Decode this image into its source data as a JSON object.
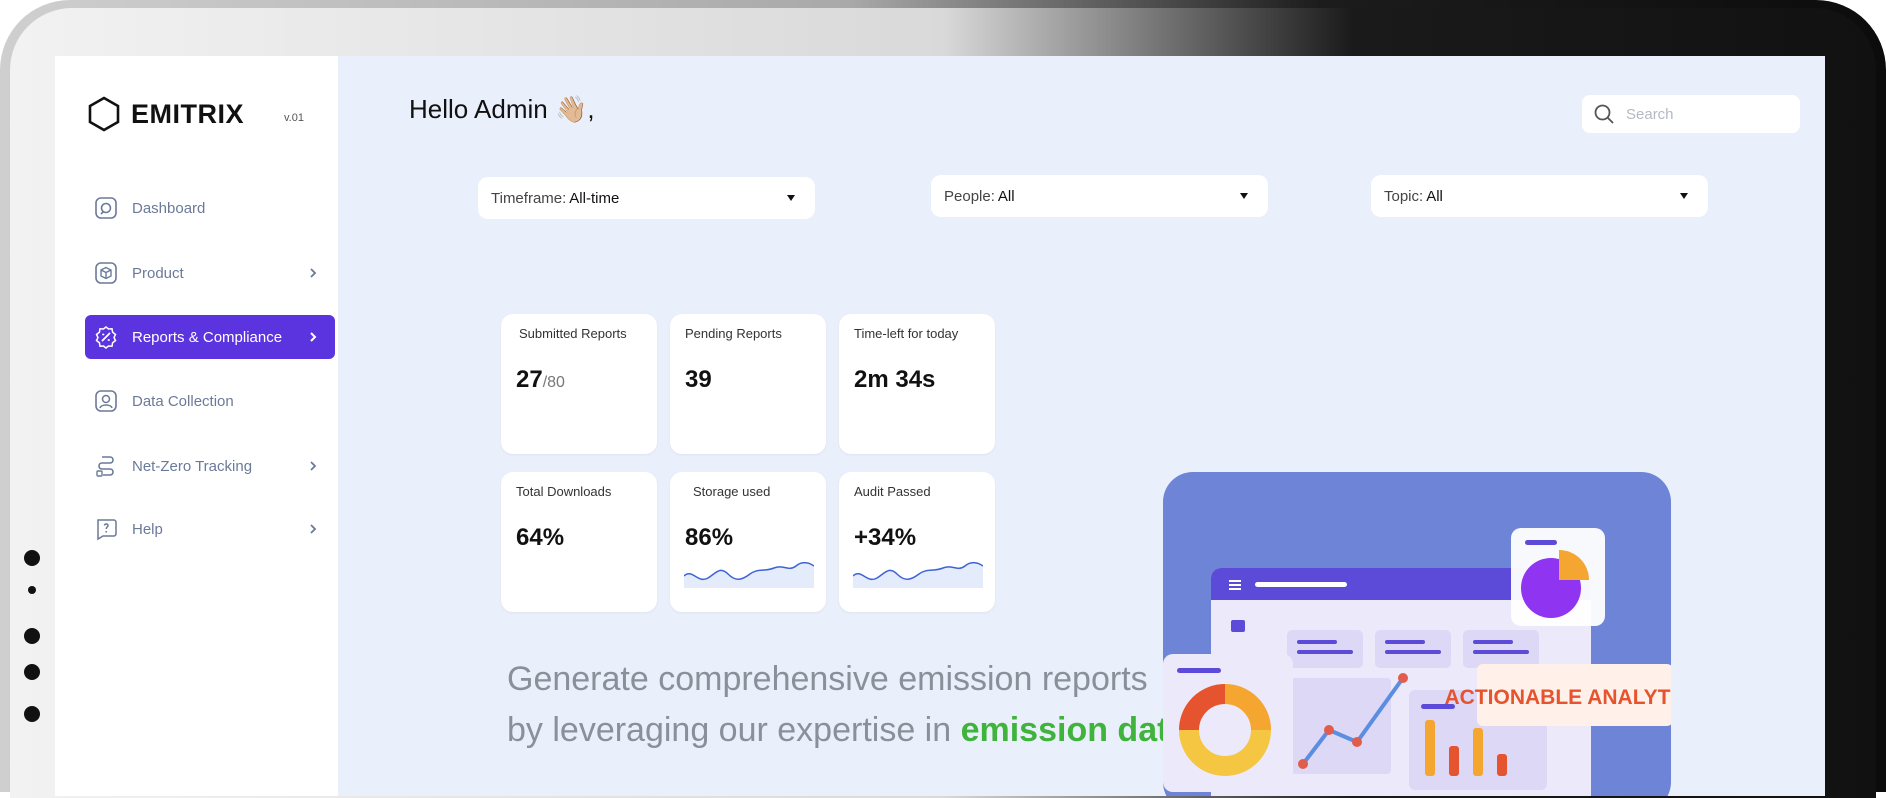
{
  "app": {
    "brand": "EMITRIX",
    "version": "v.01"
  },
  "sidebar": {
    "items": [
      {
        "label": "Dashboard",
        "icon": "dashboard-icon",
        "has_chevron": false,
        "active": false
      },
      {
        "label": "Product",
        "icon": "product-icon",
        "has_chevron": true,
        "active": false
      },
      {
        "label": "Reports & Compliance",
        "icon": "reports-icon",
        "has_chevron": true,
        "active": true
      },
      {
        "label": "Data Collection",
        "icon": "data-collection-icon",
        "has_chevron": false,
        "active": false
      },
      {
        "label": "Net-Zero Tracking",
        "icon": "net-zero-icon",
        "has_chevron": true,
        "active": false
      },
      {
        "label": "Help",
        "icon": "help-icon",
        "has_chevron": true,
        "active": false
      }
    ]
  },
  "header": {
    "greeting": "Hello Admin 👋🏼,",
    "search_placeholder": "Search"
  },
  "filters": [
    {
      "label": "Timeframe:",
      "value": "All-time"
    },
    {
      "label": "People:",
      "value": "All"
    },
    {
      "label": "Topic:",
      "value": "All"
    }
  ],
  "stats": [
    {
      "label": "Submitted Reports",
      "value": "27",
      "suffix": "/80"
    },
    {
      "label": "Pending Reports",
      "value": "39"
    },
    {
      "label": "Time-left for today",
      "value": "2m 34s"
    },
    {
      "label": "Total Downloads",
      "value": "64%"
    },
    {
      "label": "Storage used",
      "value": "86%"
    },
    {
      "label": "Audit Passed",
      "value": "+34%"
    }
  ],
  "tagline": {
    "line1": "Generate comprehensive emission reports",
    "line2": "by leveraging our expertise in ",
    "highlight": "emission data"
  },
  "illustration": {
    "banner": "ACTIONABLE ANALYTICS"
  },
  "colors": {
    "accent": "#5b34e0",
    "highlight": "#3fb33b",
    "background": "#eaf0fb",
    "illustration_bg": "#6e84d6"
  }
}
